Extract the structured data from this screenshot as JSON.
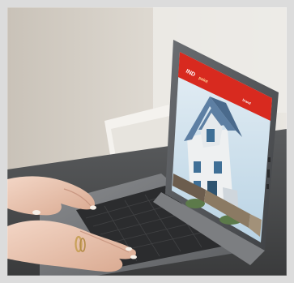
{
  "screen": {
    "brand_part1": "IND",
    "brand_part2": "paint",
    "brand_tag": "brand",
    "colors": {
      "header_red": "#d82a1f",
      "screen_sky": "#cfe2ee",
      "house_slate": "#5d7fa3",
      "wall_white": "#eef0f1"
    },
    "swatches": [
      "#7a6a5a",
      "#9b8c6e",
      "#b59f7a",
      "#c9b79a",
      "#6f7d86",
      "#8ea1a8",
      "#a5b3a0",
      "#c7c2b3"
    ]
  }
}
